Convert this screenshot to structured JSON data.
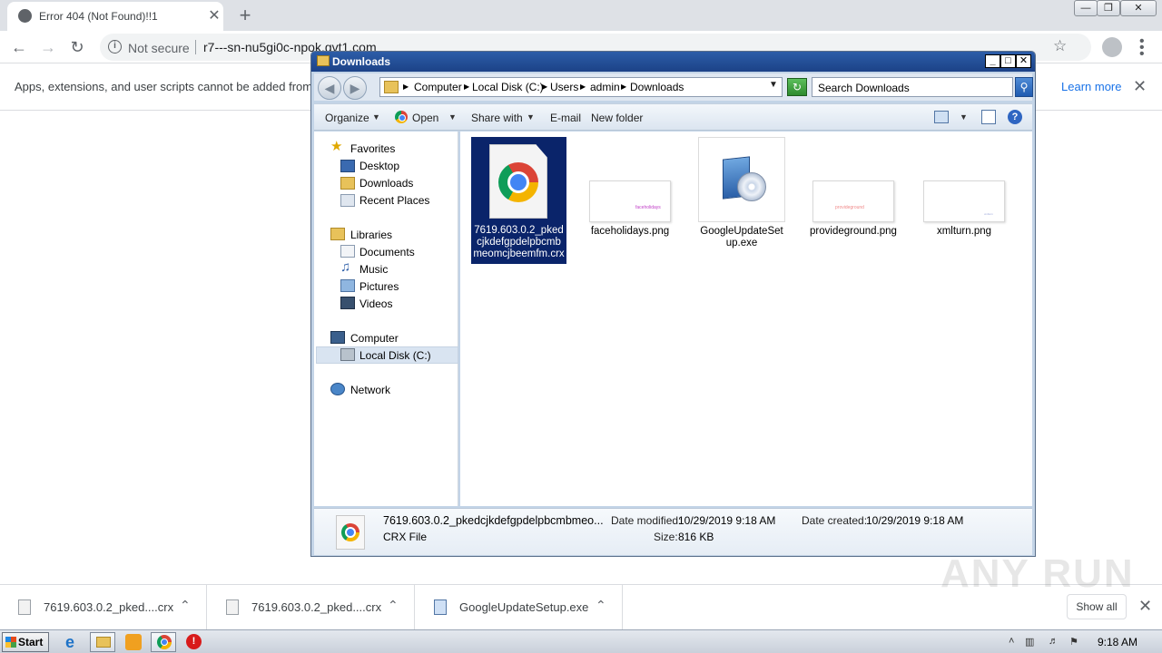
{
  "browser": {
    "tab_title": "Error 404 (Not Found)!!1",
    "tab_close": "✕",
    "new_tab": "+",
    "not_secure": "Not secure",
    "url": "r7---sn-nu5gi0c-npok.gvt1.com"
  },
  "infobar": {
    "message": "Apps, extensions, and user scripts cannot be added from th",
    "learn_more": "Learn more",
    "close": "✕"
  },
  "explorer": {
    "title": "Downloads",
    "breadcrumb": [
      "Computer",
      "Local Disk (C:)",
      "Users",
      "admin",
      "Downloads"
    ],
    "search_placeholder": "Search Downloads",
    "commands": {
      "organize": "Organize",
      "open": "Open",
      "share_with": "Share with",
      "email": "E-mail",
      "new_folder": "New folder"
    },
    "nav": {
      "favorites": "Favorites",
      "desktop": "Desktop",
      "downloads": "Downloads",
      "recent_places": "Recent Places",
      "libraries": "Libraries",
      "documents": "Documents",
      "music": "Music",
      "pictures": "Pictures",
      "videos": "Videos",
      "computer": "Computer",
      "local_disk": "Local Disk (C:)",
      "network": "Network"
    },
    "files": [
      {
        "name": "7619.603.0.2_pkedcjkdefgpdelpbcmbmeomcjbeemfm.crx",
        "icon": "chrome-file-icon",
        "selected": true
      },
      {
        "name": "faceholidays.png",
        "icon": "image-thumbnail",
        "thumb_text": "faceholidays",
        "thumb_color": "#c03ec7"
      },
      {
        "name": "GoogleUpdateSetup.exe",
        "icon": "installer-icon"
      },
      {
        "name": "provideground.png",
        "icon": "image-thumbnail",
        "thumb_text": "provideground",
        "thumb_color": "#f08a8a"
      },
      {
        "name": "xmlturn.png",
        "icon": "image-thumbnail",
        "thumb_text": "xmlturn",
        "thumb_color": "#9aa6d8"
      }
    ],
    "details": {
      "name": "7619.603.0.2_pkedcjkdefgpdelpbcmbmeo...",
      "type": "CRX File",
      "date_modified_label": "Date modified:",
      "date_modified": "10/29/2019 9:18 AM",
      "date_created_label": "Date created:",
      "date_created": "10/29/2019 9:18 AM",
      "size_label": "Size:",
      "size": "816 KB"
    }
  },
  "downloads_shelf": {
    "items": [
      {
        "name": "7619.603.0.2_pked....crx"
      },
      {
        "name": "7619.603.0.2_pked....crx"
      },
      {
        "name": "GoogleUpdateSetup.exe"
      }
    ],
    "show_all": "Show all",
    "watermark": "ANY RUN"
  },
  "taskbar": {
    "start": "Start",
    "time": "9:18 AM"
  },
  "colors": {
    "selection": "#0a246a",
    "link": "#1a73e8",
    "titlebar": "#1c4287"
  }
}
